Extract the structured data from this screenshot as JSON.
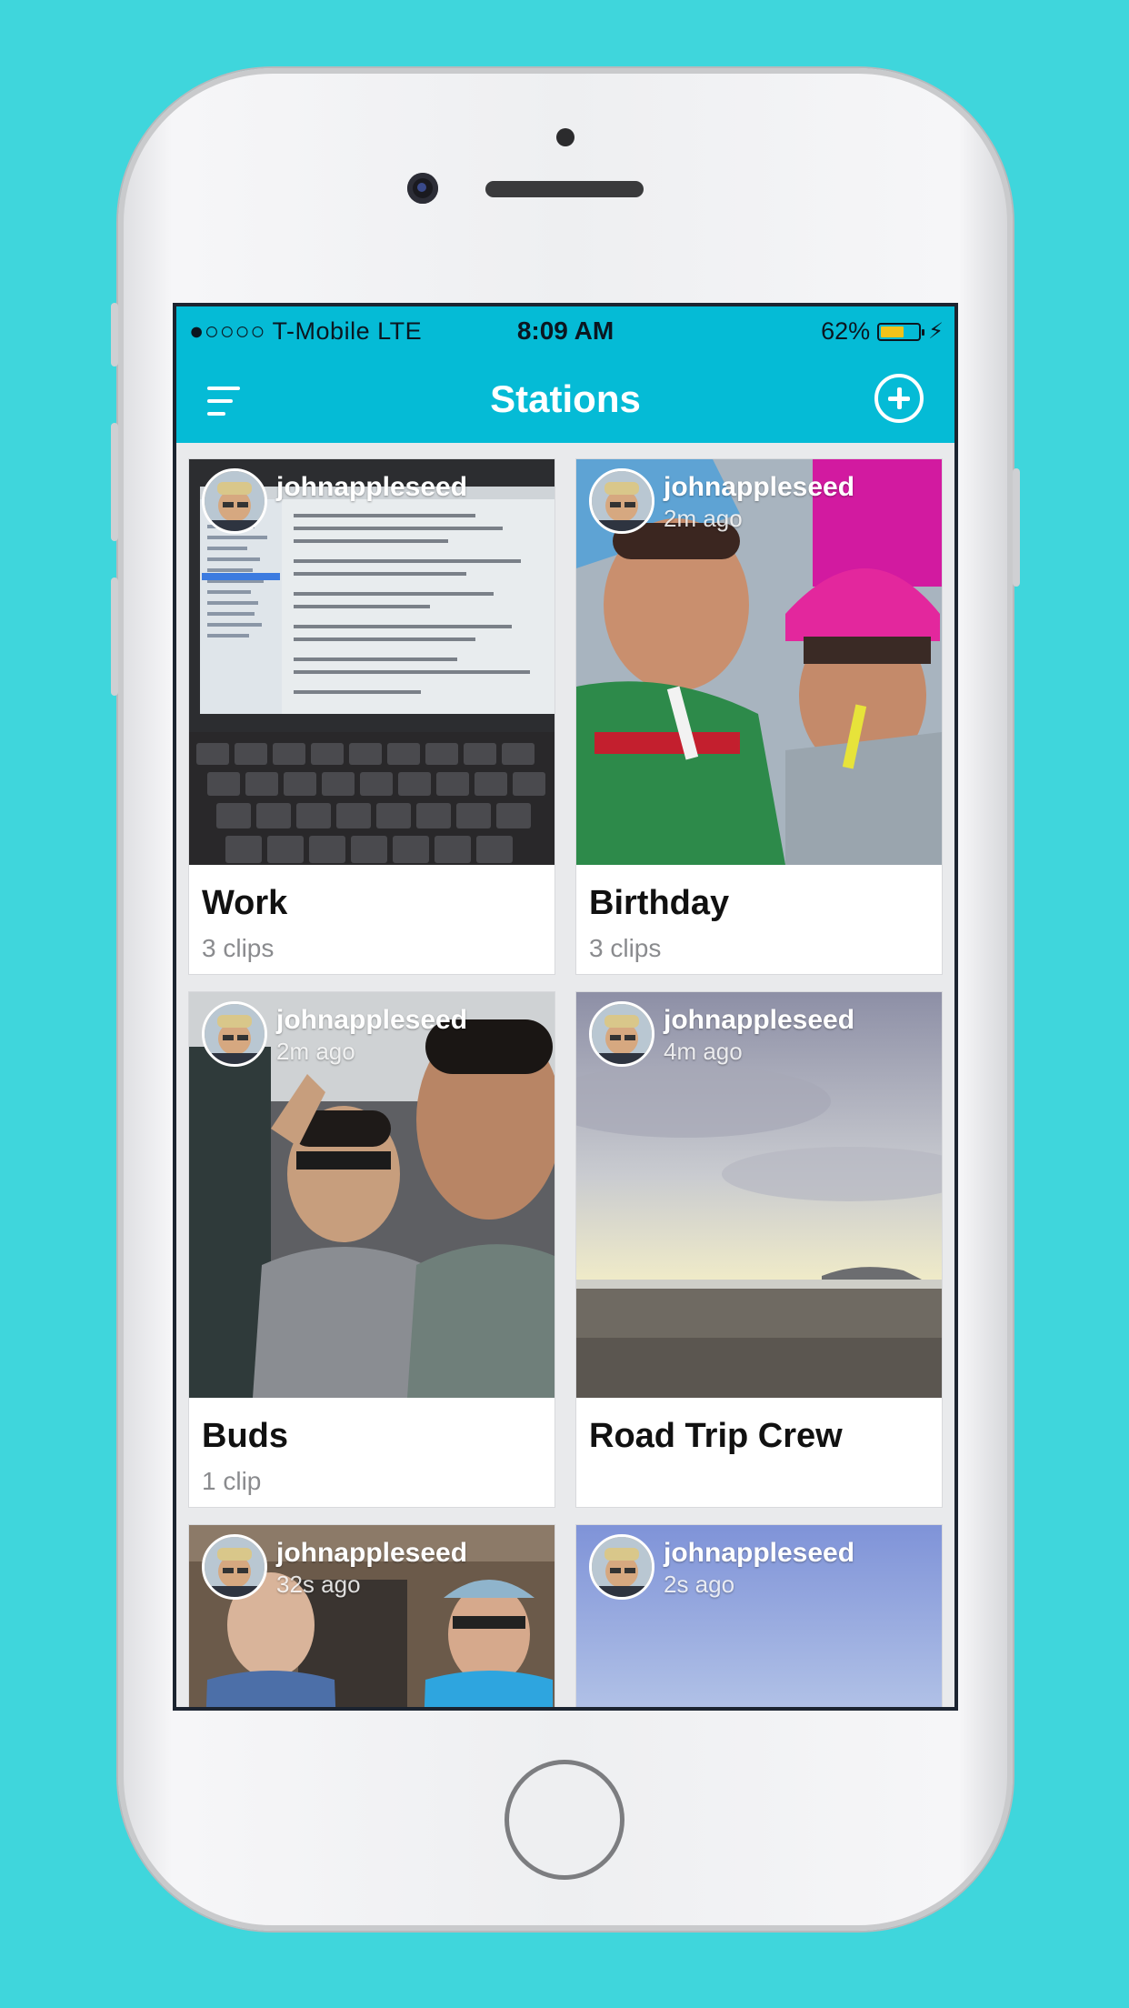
{
  "status_bar": {
    "carrier": "●○○○○ T-Mobile   LTE",
    "time": "8:09 AM",
    "battery": "62%",
    "battery_level": 0.62
  },
  "nav": {
    "title": "Stations"
  },
  "stations": [
    {
      "title": "Work",
      "subtitle": "3 clips",
      "owner": "johnappleseed",
      "time": ""
    },
    {
      "title": "Birthday",
      "subtitle": "3 clips",
      "owner": "johnappleseed",
      "time": "2m ago"
    },
    {
      "title": "Buds",
      "subtitle": "1 clip",
      "owner": "johnappleseed",
      "time": "2m ago"
    },
    {
      "title": "Road Trip Crew",
      "subtitle": "",
      "owner": "johnappleseed",
      "time": "4m ago"
    },
    {
      "title": "",
      "subtitle": "",
      "owner": "johnappleseed",
      "time": "32s ago"
    },
    {
      "title": "",
      "subtitle": "",
      "owner": "johnappleseed",
      "time": "2s ago"
    }
  ],
  "colors": {
    "background": "#3fd6dc",
    "nav_bar": "#05bbd6",
    "battery": "#f2c31a"
  }
}
